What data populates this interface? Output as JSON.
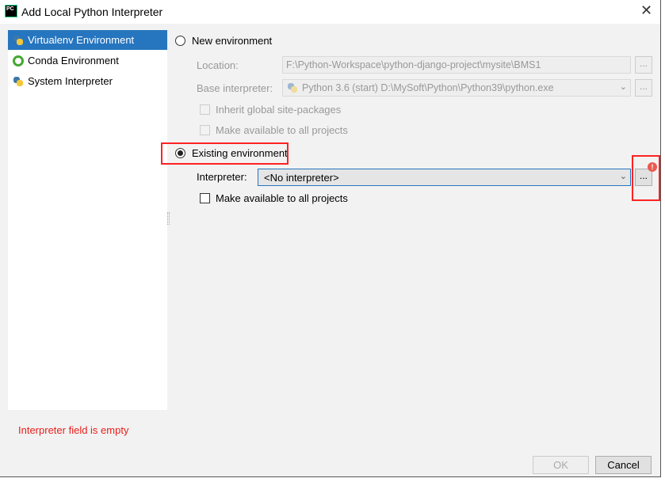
{
  "window": {
    "title": "Add Local Python Interpreter",
    "logo_text": "PC",
    "close": "✕"
  },
  "sidebar": {
    "items": [
      {
        "label": "Virtualenv Environment",
        "icon": "virtualenv-icon",
        "selected": true
      },
      {
        "label": "Conda Environment",
        "icon": "conda-icon",
        "selected": false
      },
      {
        "label": "System Interpreter",
        "icon": "python-icon",
        "selected": false
      }
    ]
  },
  "new_env": {
    "label": "New environment",
    "selected": false,
    "location_label": "Location:",
    "location_value": "F:\\Python-Workspace\\python-django-project\\mysite\\BMS1",
    "base_label": "Base interpreter:",
    "base_value": "Python 3.6 (start) D:\\MySoft\\Python\\Python39\\python.exe",
    "inherit_label": "Inherit global site-packages",
    "make_available_label": "Make available to all projects",
    "browse": "..."
  },
  "existing_env": {
    "label": "Existing environment",
    "selected": true,
    "interpreter_label": "Interpreter:",
    "interpreter_value": "<No interpreter>",
    "browse": "...",
    "error_badge": "!",
    "make_available_label": "Make available to all projects"
  },
  "error_message": "Interpreter field is empty",
  "buttons": {
    "ok": "OK",
    "cancel": "Cancel"
  },
  "colors": {
    "selection": "#2675bf",
    "error": "#e8201c",
    "highlight_box": "#ff2222"
  }
}
